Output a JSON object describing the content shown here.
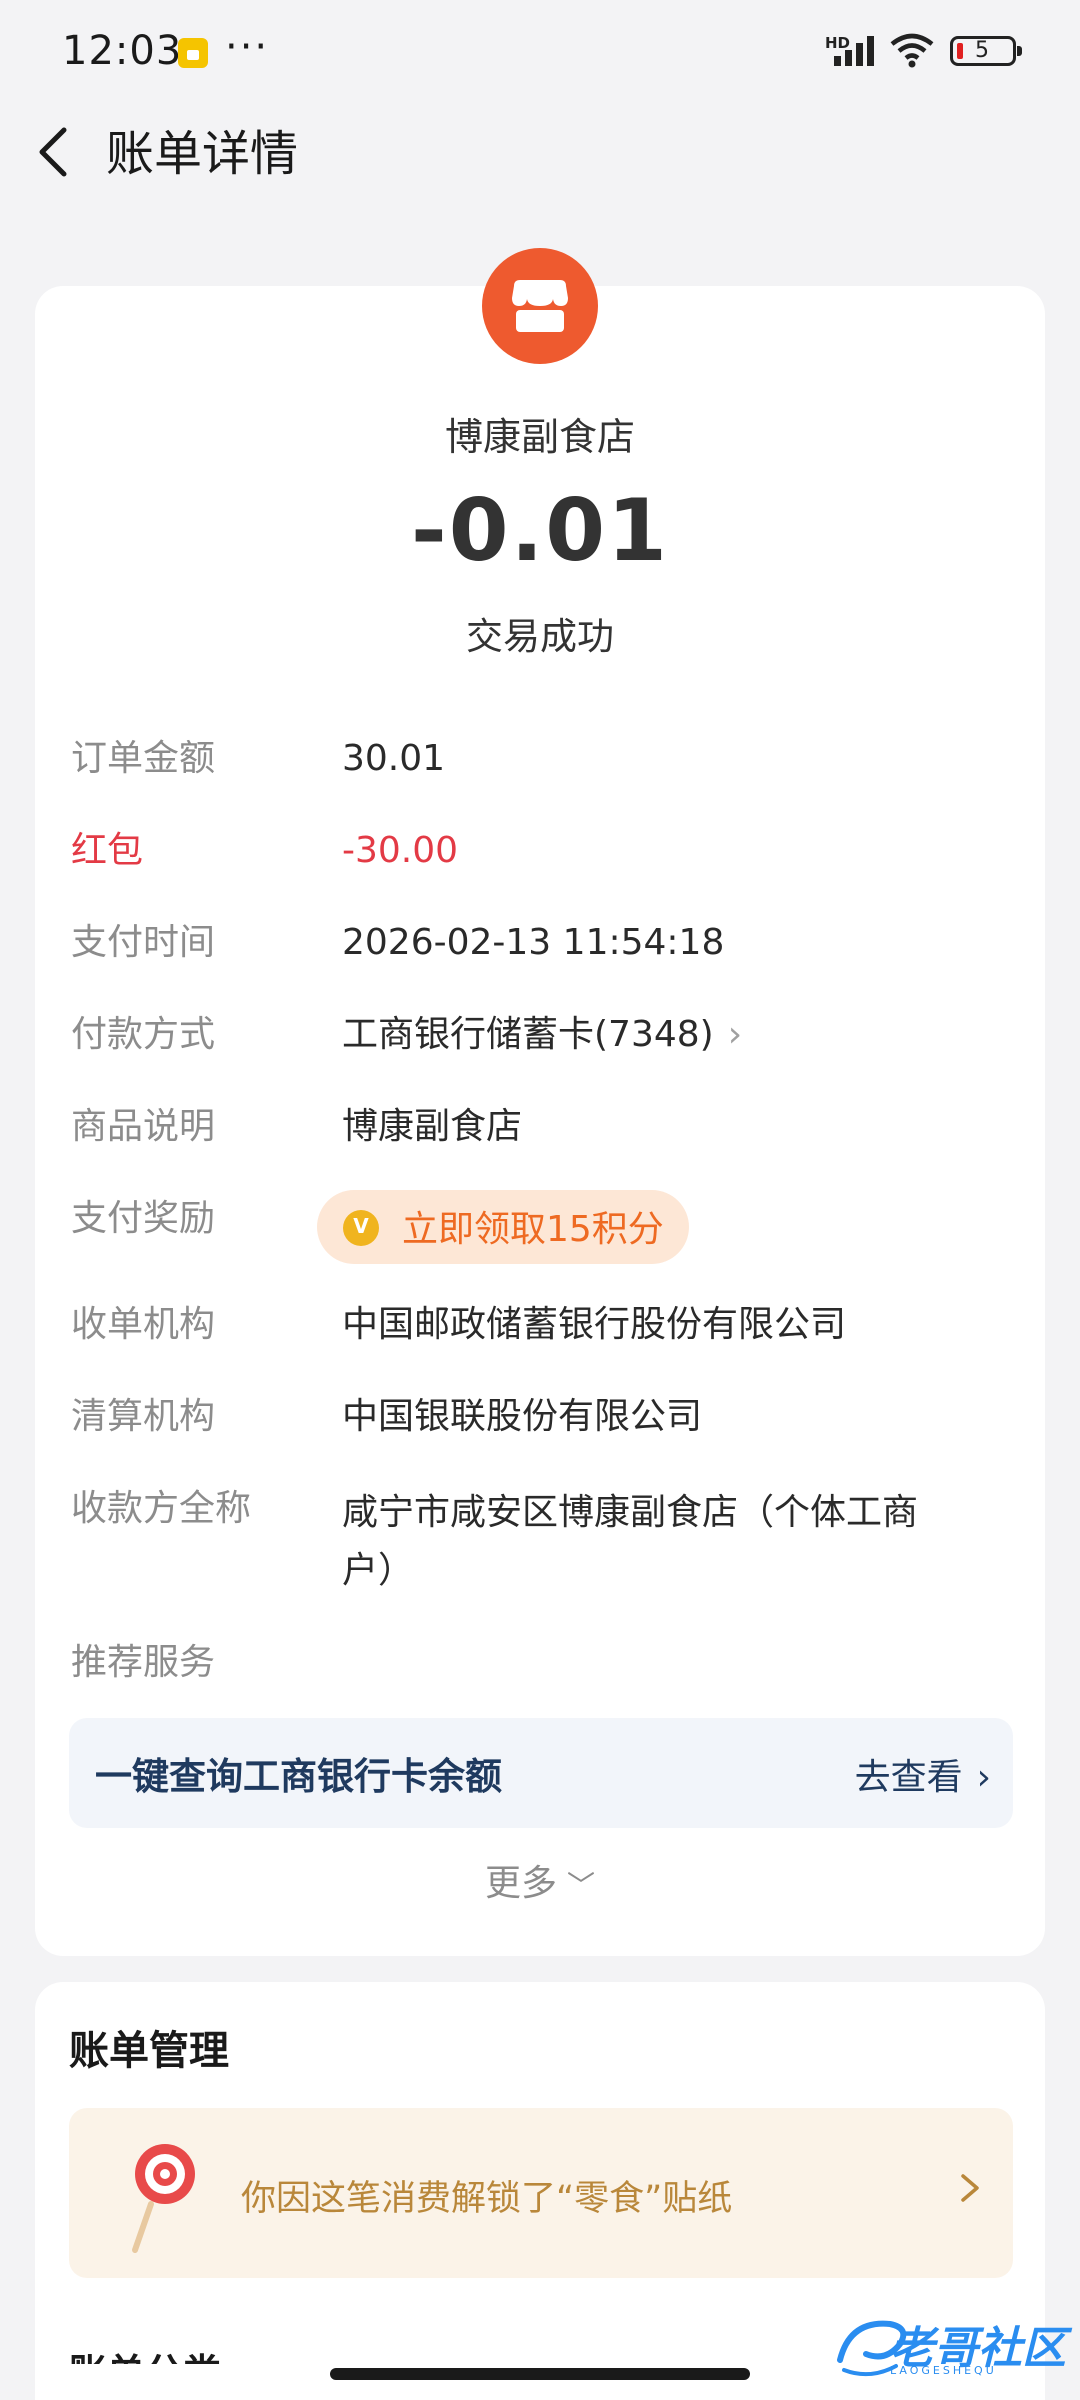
{
  "status_bar": {
    "time": "12:03",
    "more": "···",
    "network": "HD",
    "battery_level": "5"
  },
  "header": {
    "title": "账单详情"
  },
  "bill": {
    "merchant_name": "博康副食店",
    "amount": "-0.01",
    "status": "交易成功"
  },
  "details": [
    {
      "label": "订单金额",
      "value": "30.01"
    },
    {
      "label": "红包",
      "value": "-30.00"
    },
    {
      "label": "支付时间",
      "value": "2026-02-13 11:54:18"
    },
    {
      "label": "付款方式",
      "value": "工商银行储蓄卡(7348)"
    },
    {
      "label": "商品说明",
      "value": "博康副食店"
    },
    {
      "label": "支付奖励",
      "value": "立即领取15积分"
    },
    {
      "label": "收单机构",
      "value": "中国邮政储蓄银行股份有限公司"
    },
    {
      "label": "清算机构",
      "value": "中国银联股份有限公司"
    },
    {
      "label": "收款方全称",
      "value": "咸宁市咸安区博康副食店（个体工商户）"
    }
  ],
  "recommend": {
    "label": "推荐服务",
    "service_text": "一键查询工商银行卡余额",
    "service_link": "去查看"
  },
  "more_label": "更多",
  "bill_management": {
    "title": "账单管理",
    "sticker_text": "你因这笔消费解锁了“零食”贴纸",
    "next_row_partial": "账单分类"
  },
  "watermark": {
    "text": "老哥社区",
    "sub": "LAOGESHEQU"
  },
  "colors": {
    "accent_orange": "#ee5a2f",
    "red_packet": "#e33a45",
    "reward_text": "#ee6a22",
    "service_blue": "#1f3a5f",
    "sticker_gold": "#b9873a"
  }
}
